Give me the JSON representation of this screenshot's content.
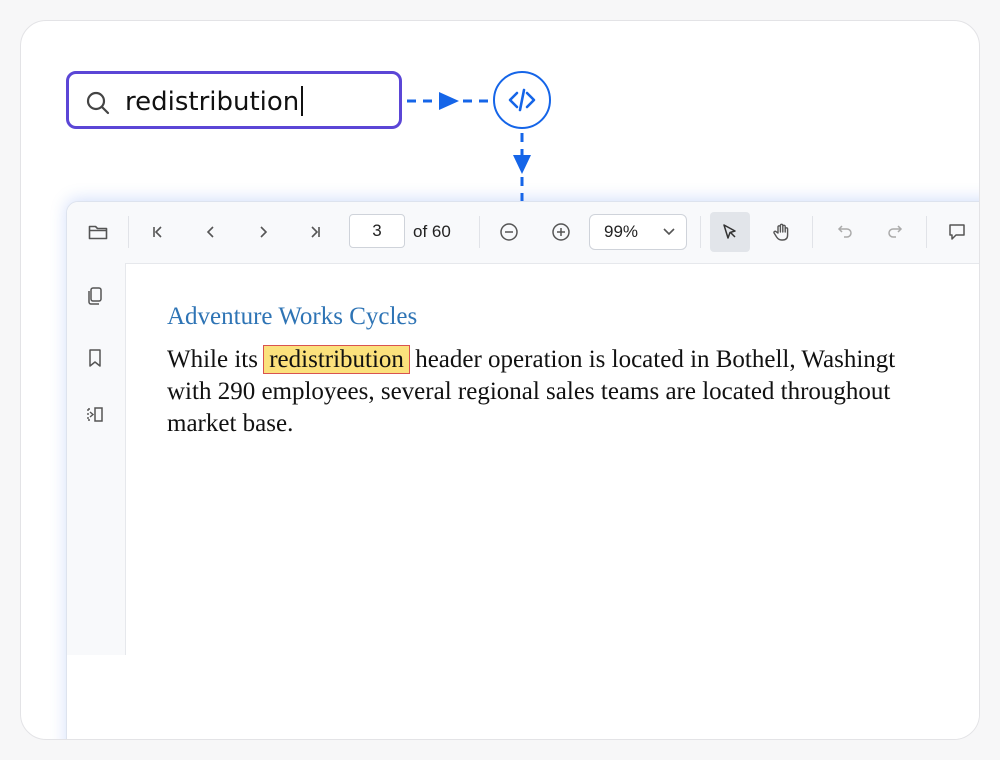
{
  "search": {
    "query": "redistribution",
    "placeholder": ""
  },
  "toolbar": {
    "page_current": "3",
    "page_of": "of 60",
    "zoom": "99%"
  },
  "document": {
    "heading": "Adventure Works Cycles",
    "line1_before": " While its",
    "highlight": "redistribution",
    "line1_after": " header operation is located in Bothell, Washingt",
    "line2": "with 290 employees, several regional sales teams are located throughout",
    "line3": "market base."
  },
  "colors": {
    "search_border": "#5b46d6",
    "connector": "#1565e8",
    "heading": "#2e74b5",
    "highlight_fill": "#fbe17c",
    "highlight_border": "#d9534f"
  },
  "icons": {
    "search": "search-icon",
    "code": "code-icon",
    "open": "folder-icon",
    "first": "first-page-icon",
    "prev": "previous-page-icon",
    "next": "next-page-icon",
    "last": "last-page-icon",
    "zoom_out": "zoom-out-icon",
    "zoom_in": "zoom-in-icon",
    "select": "text-select-icon",
    "pan": "pan-hand-icon",
    "undo": "undo-icon",
    "redo": "redo-icon",
    "comment": "comment-icon",
    "thumbnails": "page-thumbnails-icon",
    "bookmarks": "bookmark-icon",
    "organize": "organize-pages-icon"
  }
}
